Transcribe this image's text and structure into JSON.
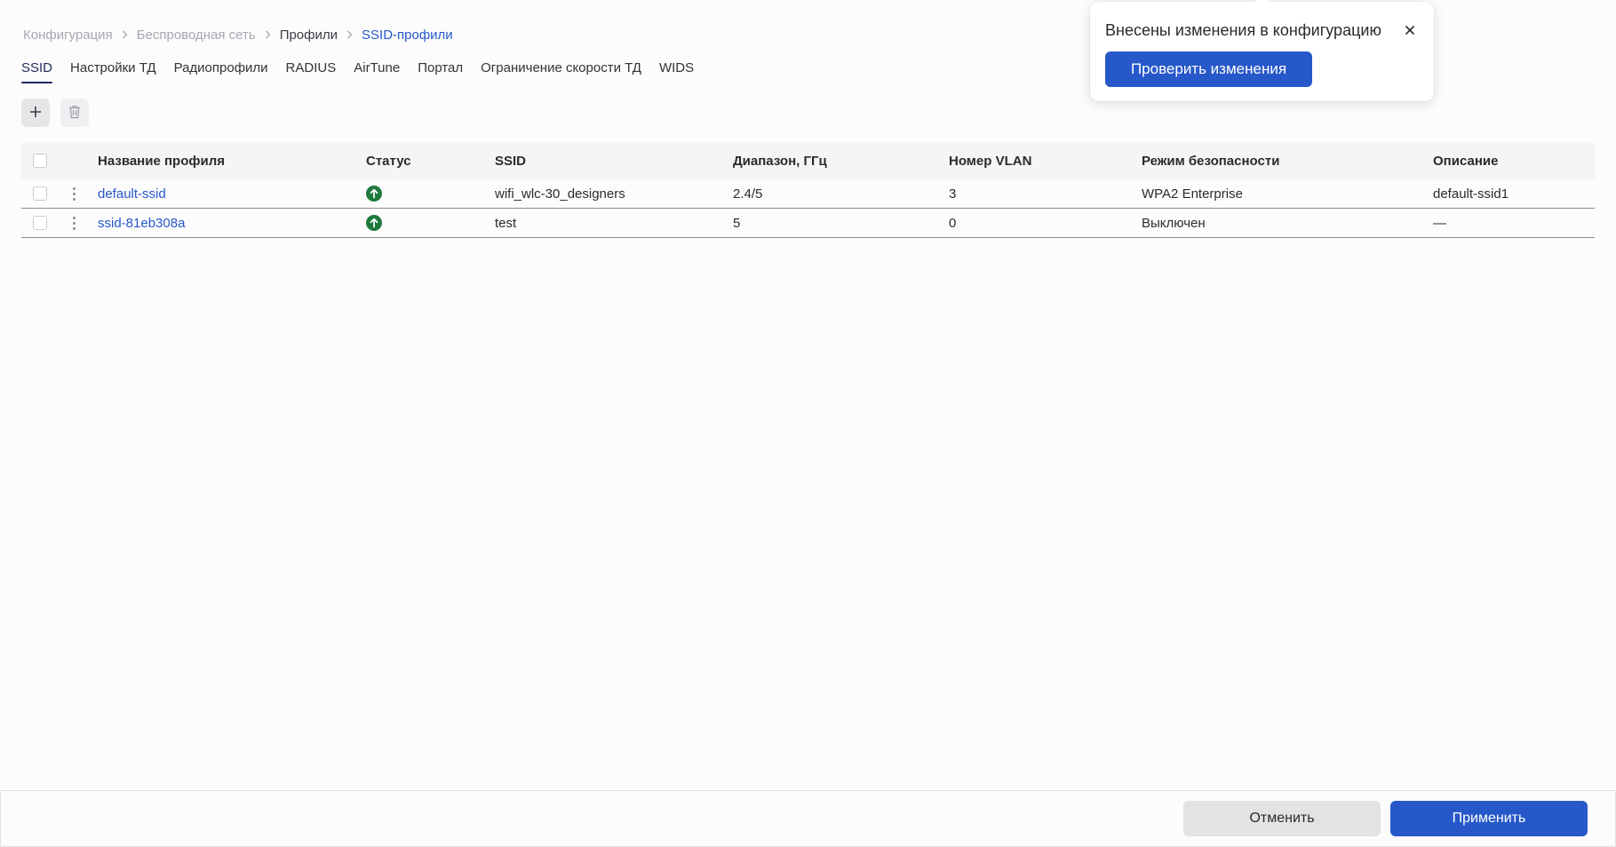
{
  "breadcrumb": [
    {
      "label": "Конфигурация"
    },
    {
      "label": "Беспроводная сеть"
    },
    {
      "label": "Профили"
    },
    {
      "label": "SSID-профили"
    }
  ],
  "tabs": [
    {
      "label": "SSID",
      "active": true
    },
    {
      "label": "Настройки ТД"
    },
    {
      "label": "Радиопрофили"
    },
    {
      "label": "RADIUS"
    },
    {
      "label": "AirTune"
    },
    {
      "label": "Портал"
    },
    {
      "label": "Ограничение скорости ТД"
    },
    {
      "label": "WIDS"
    }
  ],
  "toolbar": {
    "add_icon": "plus-icon",
    "delete_icon": "trash-icon"
  },
  "table": {
    "columns": [
      "Название профиля",
      "Статус",
      "SSID",
      "Диапазон, ГГц",
      "Номер VLAN",
      "Режим безопасности",
      "Описание"
    ],
    "rows": [
      {
        "name": "default-ssid",
        "status": "active",
        "ssid": "wifi_wlc-30_designers",
        "band": "2.4/5",
        "vlan": "3",
        "security": "WPA2 Enterprise",
        "description": "default-ssid1"
      },
      {
        "name": "ssid-81eb308a",
        "status": "active",
        "ssid": "test",
        "band": "5",
        "vlan": "0",
        "security": "Выключен",
        "description": "—"
      }
    ]
  },
  "popup": {
    "title": "Внесены изменения в конфигурацию",
    "button": "Проверить изменения"
  },
  "footer": {
    "cancel": "Отменить",
    "apply": "Применить"
  },
  "colors": {
    "accent": "#2758c9",
    "status_ok": "#1e7a3c"
  }
}
